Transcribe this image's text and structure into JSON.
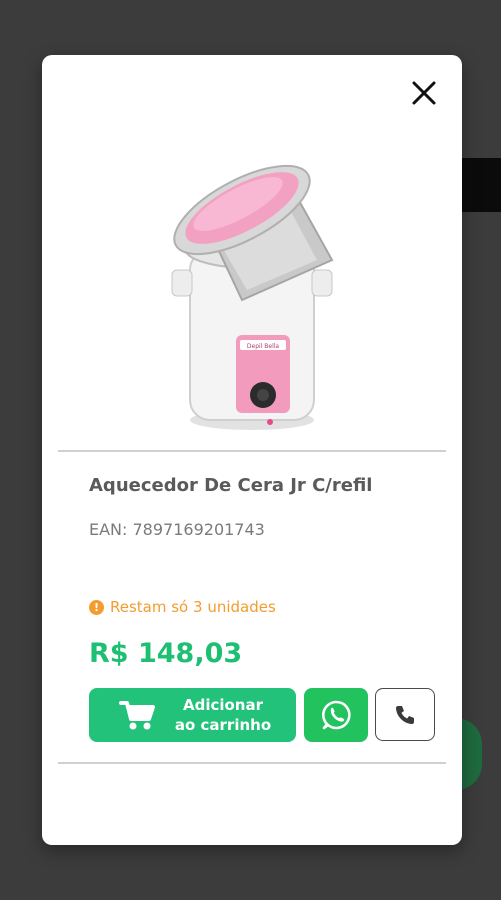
{
  "product": {
    "title": "Aquecedor De Cera Jr C/refil",
    "ean": "EAN: 7897169201743",
    "stock_warning": "Restam só 3 unidades",
    "price": "R$ 148,03",
    "image_label": "Depil Bella"
  },
  "actions": {
    "add_to_cart_line1": "Adicionar",
    "add_to_cart_line2": "ao carrinho"
  },
  "icons": {
    "close": "close-icon",
    "cart": "cart-icon",
    "whatsapp": "whatsapp-icon",
    "phone": "phone-icon",
    "warning": "warning-icon"
  },
  "colors": {
    "price": "#1dbf73",
    "add_button": "#23c27a",
    "whatsapp": "#22c25e",
    "warning": "#f39c2f"
  }
}
